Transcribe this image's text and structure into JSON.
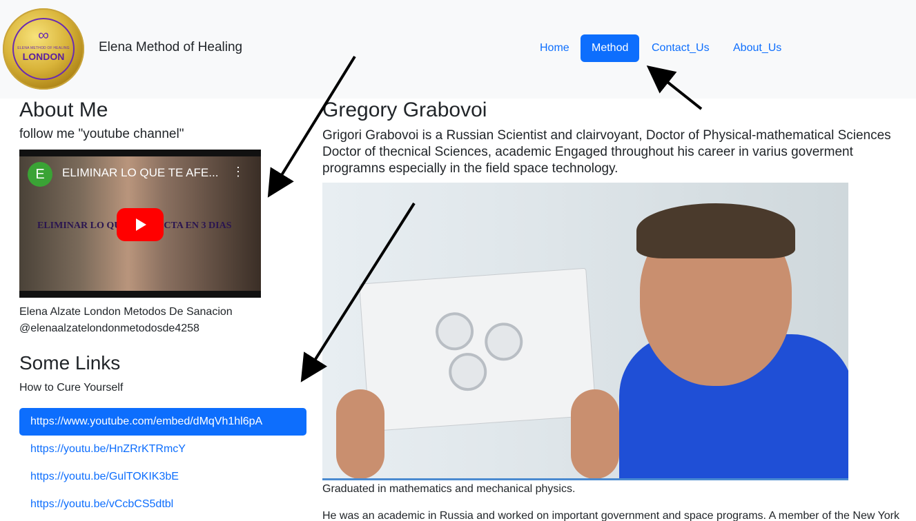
{
  "header": {
    "logo": {
      "infinity": "∞",
      "small_text": "ELENA METHOD OF HEALING",
      "city": "LONDON"
    },
    "brand": "Elena Method of Healing",
    "nav": [
      {
        "label": "Home",
        "active": false
      },
      {
        "label": "Method",
        "active": true
      },
      {
        "label": "Contact_Us",
        "active": false
      },
      {
        "label": "About_Us",
        "active": false
      }
    ]
  },
  "left": {
    "about_title": "About Me",
    "follow_text": "follow me \"youtube channel\"",
    "video": {
      "avatar_letter": "E",
      "title": "ELIMINAR LO QUE TE AFE...",
      "overlay_text": "ELIMINAR LO QUE TE AFECTA EN 3 DIAS",
      "menu_icon": "more-vertical-icon",
      "play_icon": "youtube-play-icon"
    },
    "channel_name": "Elena Alzate London Metodos De Sanacion",
    "channel_handle": "@elenaalzatelondonmetodosde4258",
    "links_title": "Some Links",
    "links_subtitle": "How to Cure Yourself",
    "links": [
      {
        "url": "https://www.youtube.com/embed/dMqVh1hl6pA",
        "active": true
      },
      {
        "url": "https://youtu.be/HnZRrKTRmcY",
        "active": false
      },
      {
        "url": "https://youtu.be/GulTOKIK3bE",
        "active": false
      },
      {
        "url": "https://youtu.be/vCcbCS5dtbl",
        "active": false
      }
    ]
  },
  "main": {
    "name": "Gregory Grabovoi",
    "bio": "Grigori Grabovoi is a Russian Scientist and clairvoyant, Doctor of Physical-mathematical Sciences Doctor of thecnical Sciences, academic Engaged throughout his career in varius goverment programns especially in the field space technology.",
    "graduated": "Graduated in mathematics and mechanical physics.",
    "academic": "He was an academic in Russia and worked on important government and space programs. A member of the New York"
  },
  "colors": {
    "primary": "#0d6efd",
    "navbar_bg": "#f8f9fa",
    "text": "#212529"
  }
}
